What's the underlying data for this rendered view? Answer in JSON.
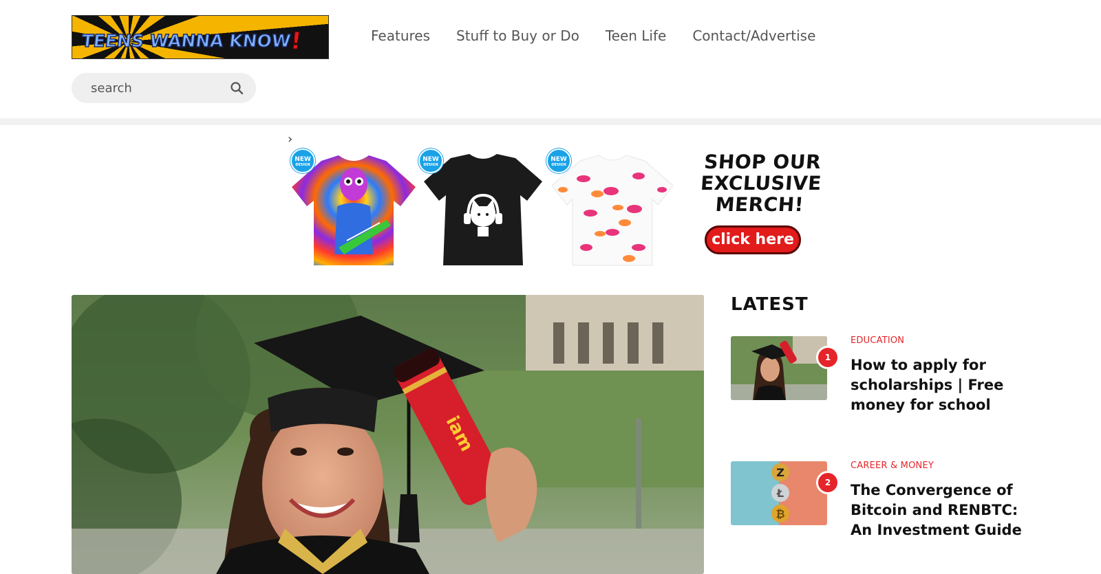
{
  "header": {
    "logo_text": "TEENS WANNA KNOW",
    "logo_bang": "!",
    "nav": [
      "Features",
      "Stuff to Buy or Do",
      "Teen Life",
      "Contact/Advertise"
    ],
    "search_placeholder": "search"
  },
  "banner": {
    "chevron": "›",
    "badge_text": "NEW",
    "badge_sub": "DESIGN",
    "merch_line1": "SHOP OUR",
    "merch_line2": "EXCLUSIVE",
    "merch_line3": "MERCH!",
    "cta_label": "click here"
  },
  "hero": {
    "cap_text": "iam"
  },
  "latest": {
    "title": "LATEST",
    "posts": [
      {
        "rank": "1",
        "category": "EDUCATION",
        "title": "How to apply for scholarships | Free money for school"
      },
      {
        "rank": "2",
        "category": "CAREER & MONEY",
        "title": "The Convergence of Bitcoin and RENBTC: An Investment Guide"
      }
    ]
  },
  "colors": {
    "accent": "#e5252a",
    "nav_text": "#555555",
    "badge": "#1aa2e8"
  }
}
